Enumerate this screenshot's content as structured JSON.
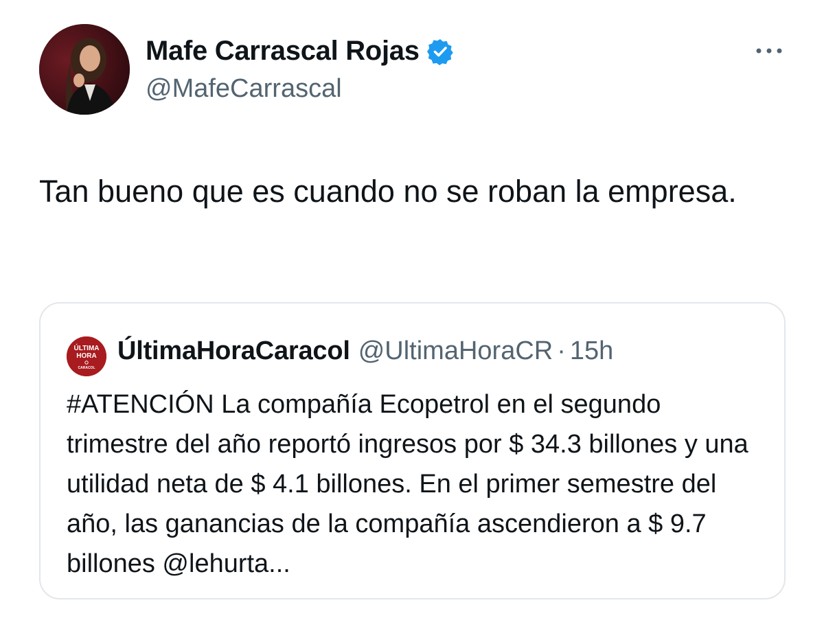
{
  "author": {
    "name": "Mafe Carrascal Rojas",
    "handle": "@MafeCarrascal",
    "verified": true
  },
  "tweet": {
    "text": "Tan bueno que es cuando no se roban la empresa."
  },
  "quoted": {
    "avatar_lines": [
      "ÚLTIMA",
      "HORA",
      "CARACOL"
    ],
    "name": "ÚltimaHoraCaracol",
    "handle": "@UltimaHoraCR",
    "separator": "·",
    "time": "15h",
    "text": "#ATENCIÓN La compañía Ecopetrol en el segundo trimestre del año reportó ingresos por $ 34.3 billones y una utilidad neta de $ 4.1 billones. En el primer semestre del año, las ganancias de la compañía ascendieron a $ 9.7 billones @lehurta..."
  },
  "icons": {
    "verified": "verified-badge-icon",
    "more": "more-options-icon"
  },
  "colors": {
    "text": "#0f1419",
    "secondary": "#536471",
    "verified": "#1d9bf0",
    "border": "#e2e7eb",
    "quote_avatar": "#a81b1f"
  }
}
